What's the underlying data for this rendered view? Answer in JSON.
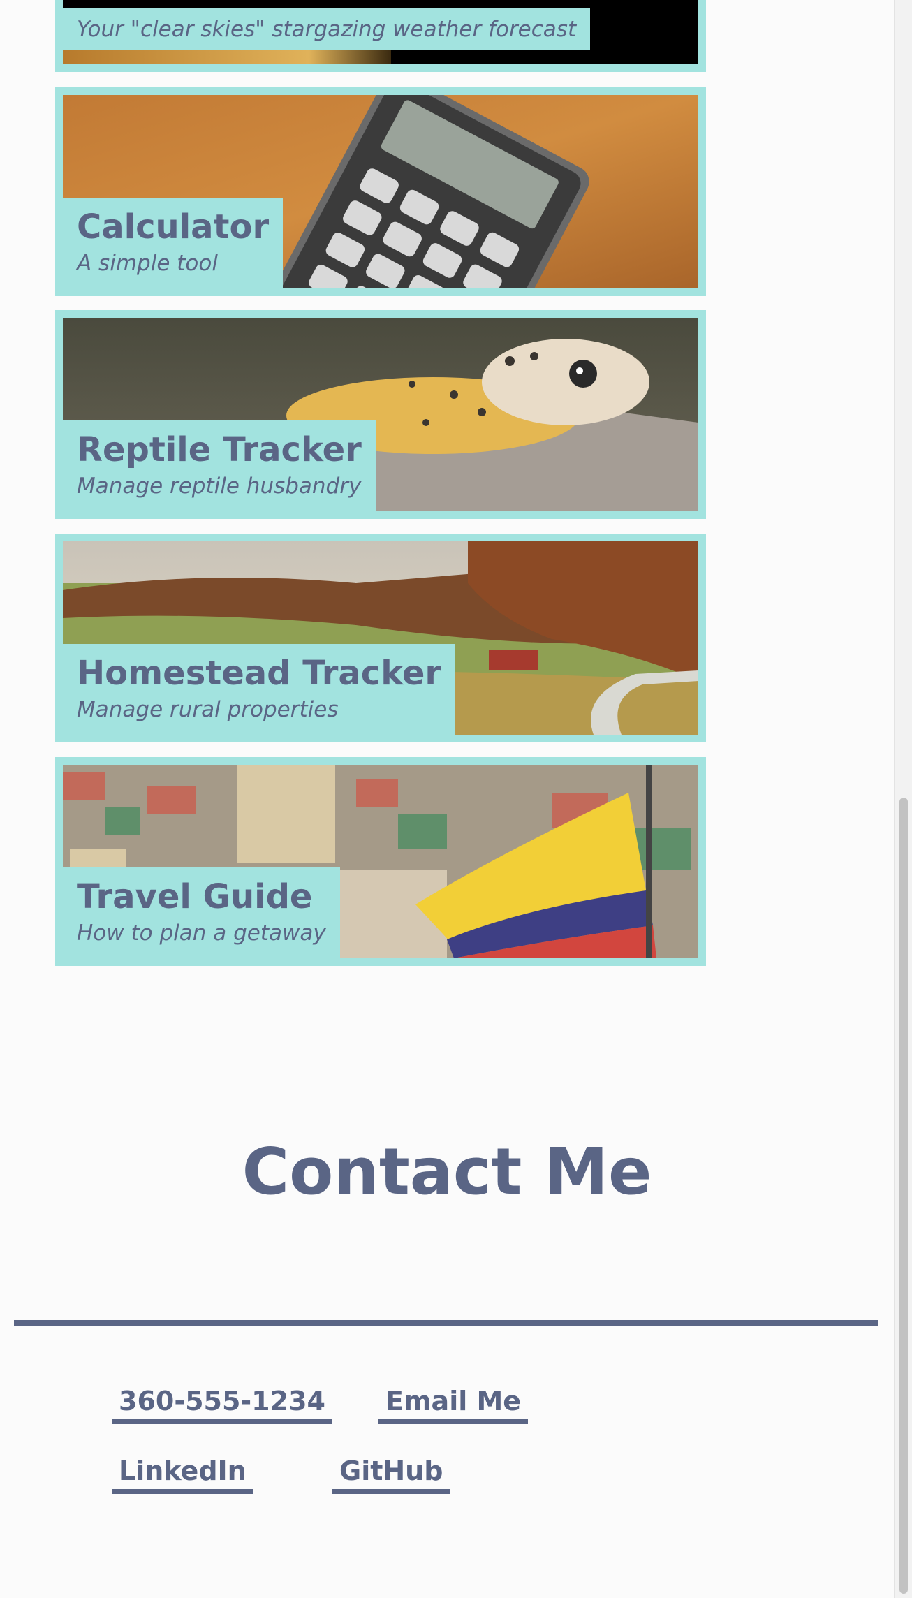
{
  "projects": [
    {
      "title": "",
      "subtitle": "Your \"clear skies\" stargazing weather forecast",
      "image": "night-sky-image"
    },
    {
      "title": "Calculator",
      "subtitle": "A simple tool",
      "image": "calculator-photo"
    },
    {
      "title": "Reptile Tracker",
      "subtitle": "Manage reptile husbandry",
      "image": "gecko-photo"
    },
    {
      "title": "Homestead Tracker",
      "subtitle": "Manage rural properties",
      "image": "countryside-photo"
    },
    {
      "title": "Travel Guide",
      "subtitle": "How to plan a getaway",
      "image": "ecuador-flag-photo"
    }
  ],
  "contact": {
    "title": "Contact Me",
    "links": {
      "phone": "360-555-1234",
      "email": "Email Me",
      "linkedin": "LinkedIn",
      "github": "GitHub"
    }
  },
  "colors": {
    "accent": "#a2e3df",
    "text": "#5a6585",
    "background": "#fbfbfb"
  }
}
